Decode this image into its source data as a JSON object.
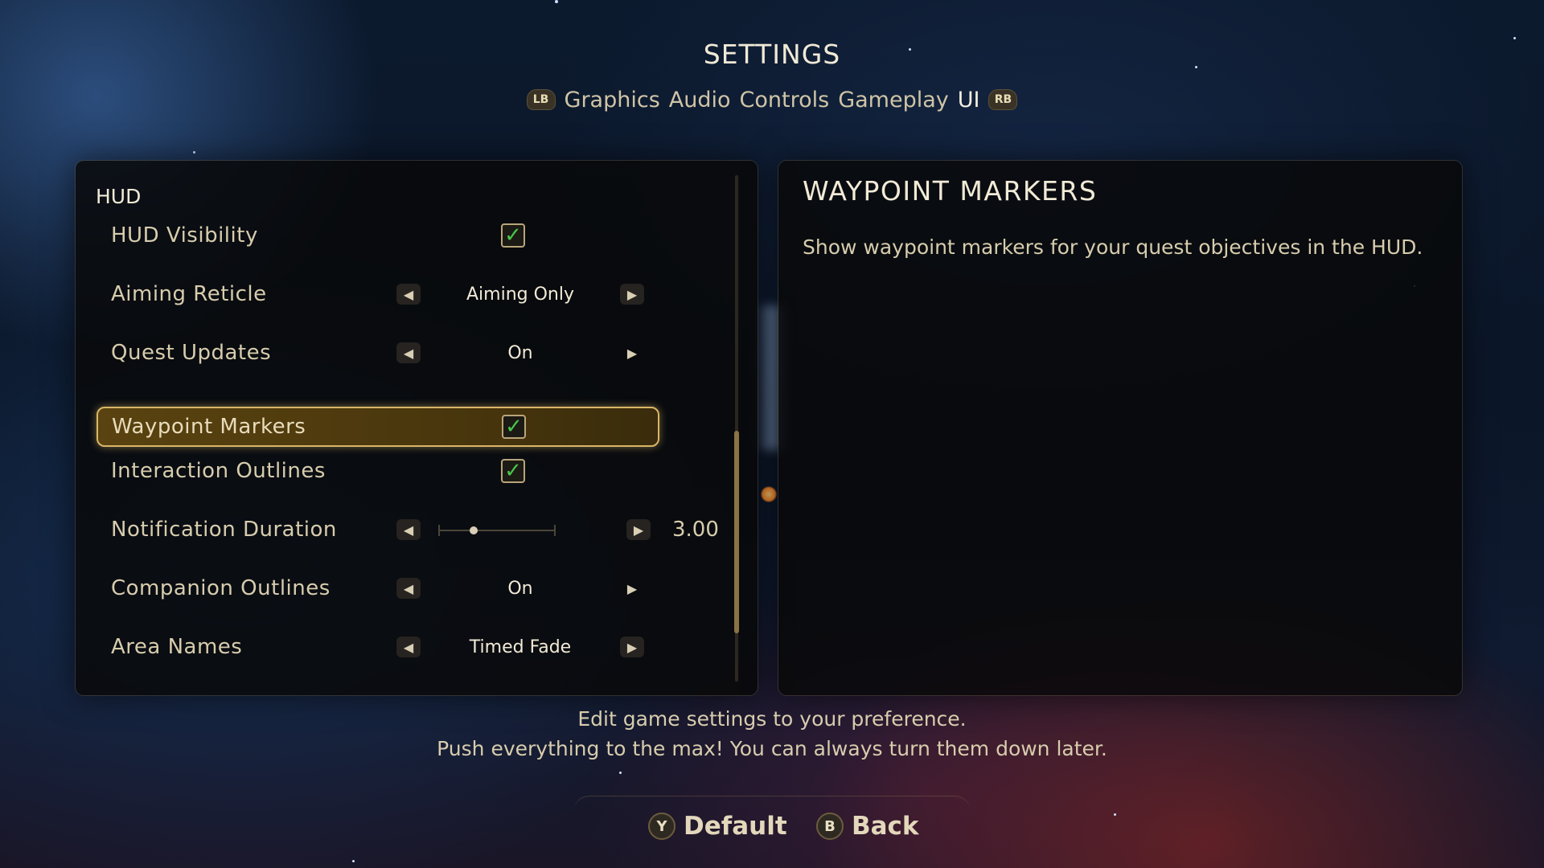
{
  "header": {
    "title": "SETTINGS",
    "left_bumper": "LB",
    "right_bumper": "RB",
    "tabs": [
      {
        "label": "Graphics",
        "active": false
      },
      {
        "label": "Audio",
        "active": false
      },
      {
        "label": "Controls",
        "active": false
      },
      {
        "label": "Gameplay",
        "active": false
      },
      {
        "label": "UI",
        "active": true
      }
    ]
  },
  "settings_panel": {
    "section": "HUD",
    "rows": [
      {
        "label": "HUD Visibility",
        "type": "checkbox",
        "checked": true
      },
      {
        "label": "Aiming Reticle",
        "type": "selector",
        "value": "Aiming Only"
      },
      {
        "label": "Quest Updates",
        "type": "selector",
        "value": "On"
      },
      {
        "label": "Waypoint Markers",
        "type": "checkbox",
        "checked": true,
        "selected": true
      },
      {
        "label": "Interaction Outlines",
        "type": "checkbox",
        "checked": true
      },
      {
        "label": "Notification Duration",
        "type": "slider",
        "value": "3.00",
        "fraction": 0.3
      },
      {
        "label": "Companion Outlines",
        "type": "selector",
        "value": "On"
      },
      {
        "label": "Area Names",
        "type": "selector",
        "value": "Timed Fade"
      }
    ],
    "check_glyph": "✓"
  },
  "description_panel": {
    "title": "WAYPOINT MARKERS",
    "text": "Show waypoint markers for your quest objectives in the HUD."
  },
  "footer": {
    "line1": "Edit game settings to your preference.",
    "line2": "Push everything to the max! You can always turn them down later.",
    "default_button": {
      "icon": "Y",
      "label": "Default"
    },
    "back_button": {
      "icon": "B",
      "label": "Back"
    }
  },
  "colors": {
    "accent_gold": "#d9b667",
    "checkmark_green": "#48c64c"
  }
}
